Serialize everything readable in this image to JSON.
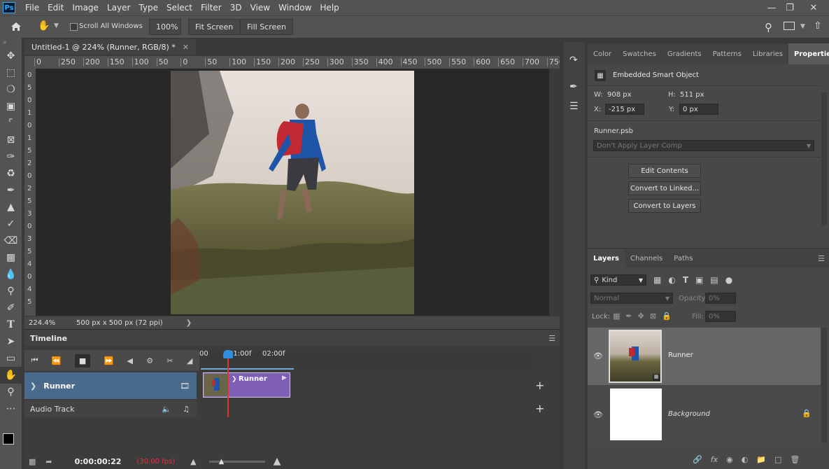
{
  "menubar": {
    "logo": "Ps",
    "items": [
      "File",
      "Edit",
      "Image",
      "Layer",
      "Type",
      "Select",
      "Filter",
      "3D",
      "View",
      "Window",
      "Help"
    ]
  },
  "options": {
    "scroll_all_label": "Scroll All Windows",
    "zoom_value": "100%",
    "fit_screen": "Fit Screen",
    "fill_screen": "Fill Screen"
  },
  "document": {
    "tab_title": "Untitled-1 @ 224% (Runner, RGB/8) *",
    "ruler_h": [
      "0",
      "250",
      "200",
      "150",
      "100",
      "50",
      "0",
      "50",
      "100",
      "150",
      "200",
      "250",
      "300",
      "350",
      "400",
      "450",
      "500",
      "550",
      "600",
      "650",
      "700",
      "750"
    ],
    "ruler_v": [
      "0",
      "5",
      "0",
      "1",
      "0",
      "1",
      "5",
      "2",
      "0",
      "2",
      "5",
      "3",
      "0",
      "3",
      "5",
      "4",
      "0",
      "4",
      "5"
    ],
    "zoom_status": "224.4%",
    "size_status": "500 px x 500 px (72 ppi)"
  },
  "timeline": {
    "title": "Timeline",
    "ticks": [
      "00",
      "01:00f",
      "02:00f"
    ],
    "track_name": "Runner",
    "clip_label": "Runner",
    "audio_label": "Audio Track",
    "timecode": "0:00:00:22",
    "fps": "(30.00 fps)"
  },
  "properties": {
    "tabs": [
      "Color",
      "Swatches",
      "Gradients",
      "Patterns",
      "Libraries",
      "Properties"
    ],
    "active_tab": "Properties",
    "kind": "Embedded Smart Object",
    "w_label": "W:",
    "w_value": "908 px",
    "h_label": "H:",
    "h_value": "511 px",
    "x_label": "X:",
    "x_value": "-215 px",
    "y_label": "Y:",
    "y_value": "0 px",
    "file": "Runner.psb",
    "layer_comp": "Don't Apply Layer Comp",
    "buttons": [
      "Edit Contents",
      "Convert to Linked...",
      "Convert to Layers"
    ]
  },
  "layers": {
    "tabs": [
      "Layers",
      "Channels",
      "Paths"
    ],
    "filter_kind": "Kind",
    "blend_mode": "Normal",
    "opacity_label": "Opacity:",
    "opacity_value": "0%",
    "lock_label": "Lock:",
    "fill_label": "Fill:",
    "fill_value": "0%",
    "rows": [
      {
        "name": "Runner"
      },
      {
        "name": "Background"
      }
    ]
  },
  "colors": {
    "accent": "#31a8ff",
    "clip": "#7e5fb5",
    "track": "#4a6a8b",
    "playhead": "#d8363d",
    "fps": "#d8363d"
  }
}
